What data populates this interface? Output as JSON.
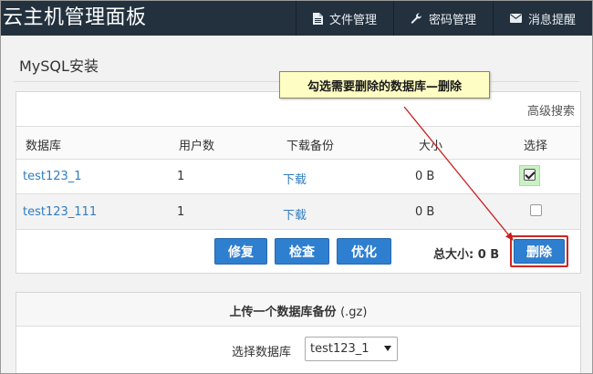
{
  "app": {
    "title": "云主机管理面板"
  },
  "nav": [
    {
      "label": "文件管理",
      "icon": "file-icon"
    },
    {
      "label": "密码管理",
      "icon": "wrench-icon"
    },
    {
      "label": "消息提醒",
      "icon": "envelope-icon"
    }
  ],
  "page": {
    "title": "MySQL安装"
  },
  "callout": {
    "text": "勾选需要删除的数据库—删除"
  },
  "db_panel": {
    "advanced_search": "高级搜索",
    "columns": [
      "数据库",
      "用户数",
      "下载备份",
      "大小",
      "选择"
    ],
    "rows": [
      {
        "name": "test123_1",
        "users": "1",
        "download": "下载",
        "size": "0 B",
        "checked": true
      },
      {
        "name": "test123_111",
        "users": "1",
        "download": "下载",
        "size": "0 B",
        "checked": false
      }
    ],
    "buttons": {
      "repair": "修复",
      "check": "检查",
      "optimize": "优化",
      "delete": "删除"
    },
    "total_label": "总大小:",
    "total_value": "0 B"
  },
  "upload_panel": {
    "title": "上传一个数据库备份",
    "title_suffix": "(.gz)",
    "select_label": "选择数据库",
    "select_value": "test123_1"
  },
  "colors": {
    "topbar": "#23313e",
    "link": "#2f7dc0",
    "button": "#2f7fd0",
    "highlight": "#d02323",
    "callout_bg": "#fefdc3"
  }
}
